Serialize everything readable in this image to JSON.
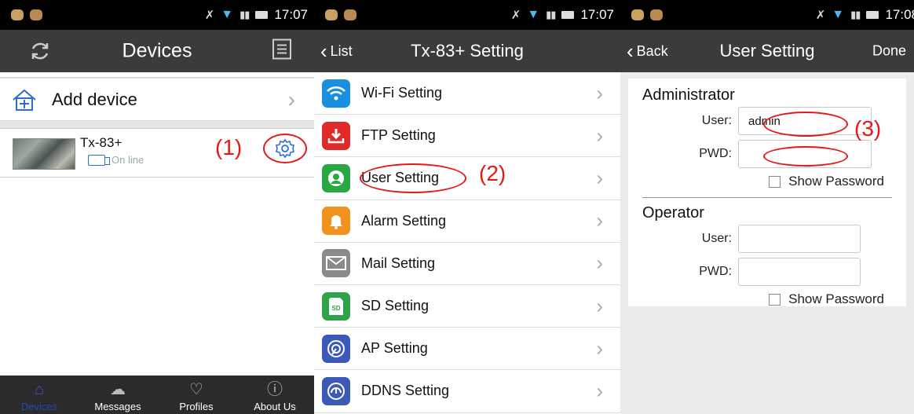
{
  "status": {
    "time_1": "17:07",
    "time_2": "17:07",
    "time_3": "17:08"
  },
  "screen1": {
    "title": "Devices",
    "add_device": "Add device",
    "device": {
      "name": "Tx-83+",
      "status": "On line"
    },
    "annotation": "(1)",
    "tabs": [
      {
        "label": "Devices",
        "icon": "home-icon"
      },
      {
        "label": "Messages",
        "icon": "cloud-icon"
      },
      {
        "label": "Profiles",
        "icon": "heart-icon"
      },
      {
        "label": "About Us",
        "icon": "info-icon"
      }
    ]
  },
  "screen2": {
    "back": "List",
    "title": "Tx-83+ Setting",
    "annotation": "(2)",
    "items": [
      {
        "label": "Wi-Fi Setting",
        "icon": "wifi-icon",
        "color": "#1a8fe0"
      },
      {
        "label": "FTP Setting",
        "icon": "download-icon",
        "color": "#e02a2a"
      },
      {
        "label": "User Setting",
        "icon": "user-icon",
        "color": "#27a843"
      },
      {
        "label": "Alarm Setting",
        "icon": "bell-icon",
        "color": "#f2911d"
      },
      {
        "label": "Mail Setting",
        "icon": "mail-icon",
        "color": "#8a8a8a"
      },
      {
        "label": "SD Setting",
        "icon": "sd-card-icon",
        "color": "#2da44a"
      },
      {
        "label": "AP Setting",
        "icon": "ap-icon",
        "color": "#3a59b8"
      },
      {
        "label": "DDNS Setting",
        "icon": "ddns-icon",
        "color": "#3a59b8"
      }
    ]
  },
  "screen3": {
    "back": "Back",
    "title": "User Setting",
    "done": "Done",
    "annotation": "(3)",
    "admin": {
      "title": "Administrator",
      "user_label": "User:",
      "user_value": "admin",
      "pwd_label": "PWD:",
      "pwd_value": "",
      "show_pwd": "Show Password"
    },
    "operator": {
      "title": "Operator",
      "user_label": "User:",
      "user_value": "",
      "pwd_label": "PWD:",
      "pwd_value": "",
      "show_pwd": "Show Password"
    }
  },
  "colors": {
    "annotation": "#e51818",
    "navbar": "#3b3b3b",
    "tabbar": "#2b2b2b",
    "active_tab": "#2846b0"
  }
}
